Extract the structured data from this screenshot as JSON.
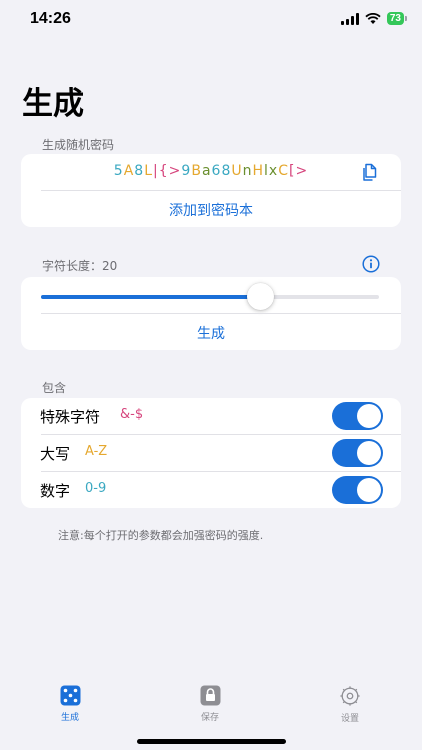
{
  "status_bar": {
    "time": "14:26",
    "battery": "73"
  },
  "page_title": "生成",
  "generate_section": {
    "label": "生成随机密码",
    "password_chars": [
      {
        "c": "5",
        "color": "#3aa8c1"
      },
      {
        "c": "A",
        "color": "#e5a82f"
      },
      {
        "c": "8",
        "color": "#3aa8c1"
      },
      {
        "c": "L",
        "color": "#e5a82f"
      },
      {
        "c": "|",
        "color": "#d6457d"
      },
      {
        "c": "{",
        "color": "#d6457d"
      },
      {
        "c": ">",
        "color": "#d6457d"
      },
      {
        "c": "9",
        "color": "#3aa8c1"
      },
      {
        "c": "B",
        "color": "#e5a82f"
      },
      {
        "c": "a",
        "color": "#6a8f2e"
      },
      {
        "c": "6",
        "color": "#3aa8c1"
      },
      {
        "c": "8",
        "color": "#3aa8c1"
      },
      {
        "c": "U",
        "color": "#e5a82f"
      },
      {
        "c": "n",
        "color": "#6a8f2e"
      },
      {
        "c": "H",
        "color": "#e5a82f"
      },
      {
        "c": "l",
        "color": "#6a8f2e"
      },
      {
        "c": "x",
        "color": "#6a8f2e"
      },
      {
        "c": "C",
        "color": "#e5a82f"
      },
      {
        "c": "[",
        "color": "#d6457d"
      },
      {
        "c": ">",
        "color": "#d6457d"
      }
    ],
    "add_button": "添加到密码本"
  },
  "length_section": {
    "label": "字符长度：20",
    "slider_fraction": 0.65,
    "generate_button": "生成"
  },
  "include_section": {
    "label": "包含",
    "options": [
      {
        "label": "特殊字符",
        "hint": "&-$",
        "hint_color": "#d6457d",
        "enabled": true
      },
      {
        "label": "大写",
        "hint": "A-Z",
        "hint_color": "#e5a82f",
        "enabled": true
      },
      {
        "label": "数字",
        "hint": "0-9",
        "hint_color": "#3aa8c1",
        "enabled": true
      }
    ]
  },
  "note": "注意:每个打开的参数都会加强密码的强度.",
  "tab_bar": {
    "tabs": [
      {
        "label": "生成",
        "icon": "dice-icon",
        "active": true
      },
      {
        "label": "保存",
        "icon": "lock-icon",
        "active": false
      },
      {
        "label": "设置",
        "icon": "gear-icon",
        "active": false
      }
    ]
  },
  "colors": {
    "accent": "#1a6fd8",
    "background": "#f2f2f7"
  }
}
